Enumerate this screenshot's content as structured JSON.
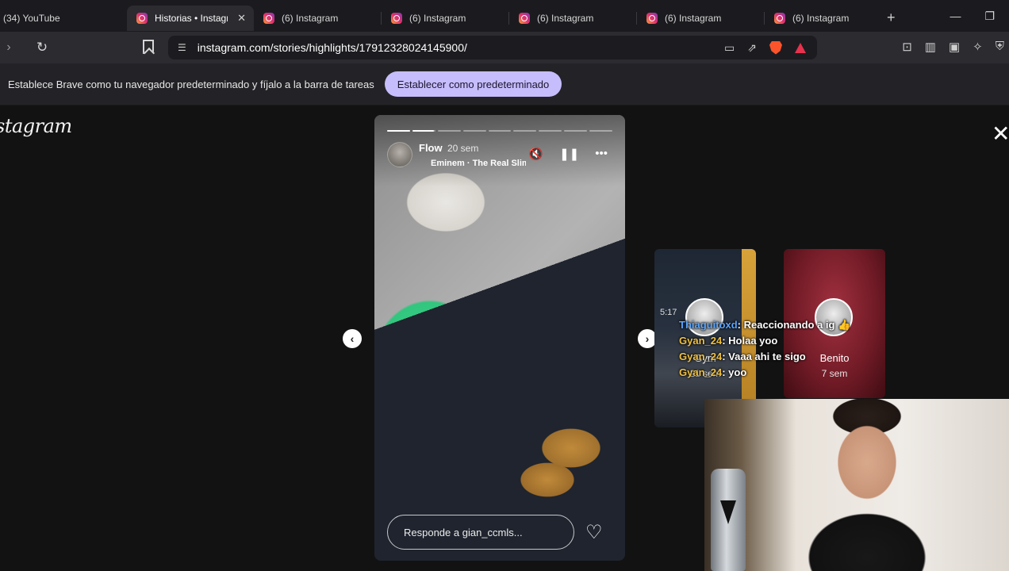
{
  "browser": {
    "tabs": [
      {
        "label": "(34) YouTube",
        "active": false
      },
      {
        "label": "Historias • Instagram",
        "active": true
      },
      {
        "label": "(6) Instagram",
        "active": false
      },
      {
        "label": "(6) Instagram",
        "active": false
      },
      {
        "label": "(6) Instagram",
        "active": false
      },
      {
        "label": "(6) Instagram",
        "active": false
      },
      {
        "label": "(6) Instagram",
        "active": false
      }
    ],
    "url": "instagram.com/stories/highlights/17912328024145900/",
    "new_tab_glyph": "+",
    "close_tab_glyph": "✕"
  },
  "infobar": {
    "message": "Establece Brave como tu navegador predeterminado y fíjalo a la barra de tareas",
    "button_label": "Establecer como predeterminado"
  },
  "instagram": {
    "logo_text": "Instagram",
    "story": {
      "username": "Flow",
      "time": "20 sem",
      "music": "Eminem · The Real Slim Shady",
      "progress_segments": 9,
      "progress_current_segment": 2,
      "progress_current_fill": 0.95,
      "reply_placeholder": "Responde a gian_ccmls...",
      "icons": {
        "mute": "speaker-muted-icon",
        "pause": "pause-icon",
        "more": "more-options-icon",
        "like": "heart-icon"
      }
    },
    "next_stories": [
      {
        "name": "Gym",
        "time": "21 sem"
      },
      {
        "name": "Benito",
        "time": "7 sem"
      }
    ]
  },
  "overlay_chat": {
    "time": "5:17",
    "messages": [
      {
        "user": "Thiaguitoxd",
        "text": "Reaccionando a ig 👍"
      },
      {
        "user": "Gyan_24",
        "text": "Holaa yoo"
      },
      {
        "user": "Gyan_24",
        "text": "Vaaa ahi te sigo"
      },
      {
        "user": "Gyan_24",
        "text": "yoo"
      }
    ]
  },
  "colors": {
    "infobar_button": "#c6bdfc",
    "accent_user_1": "#5aa6ff",
    "accent_user_2": "#f0c140"
  }
}
